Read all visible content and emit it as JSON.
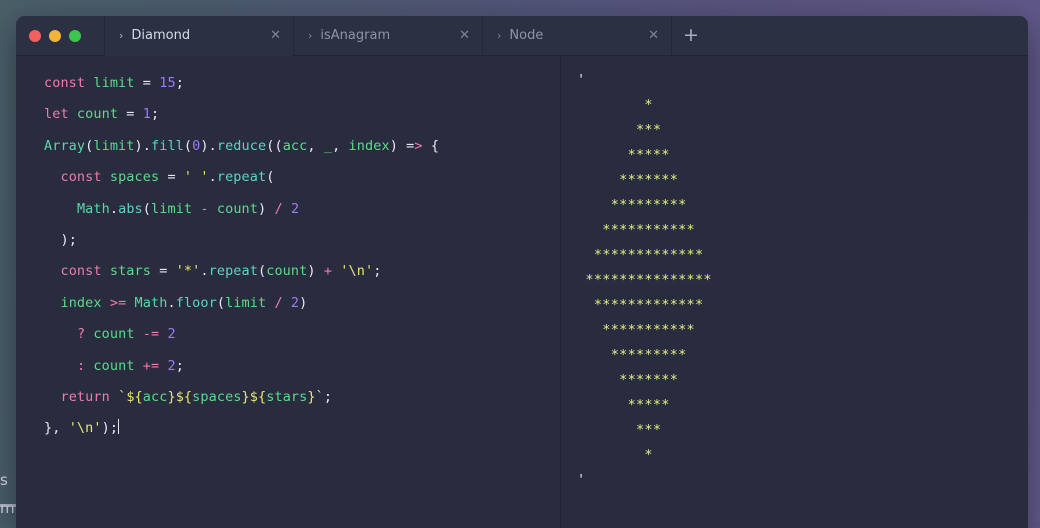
{
  "window": {
    "traffic_lights": [
      {
        "name": "close",
        "color": "#f2615c"
      },
      {
        "name": "minimize",
        "color": "#f2b33d"
      },
      {
        "name": "zoom",
        "color": "#3dc64c"
      }
    ],
    "new_tab_label": "+"
  },
  "tabs": [
    {
      "chevron": "›",
      "label": "Diamond",
      "close": "✕",
      "active": true
    },
    {
      "chevron": "›",
      "label": "isAnagram",
      "close": "✕",
      "active": false
    },
    {
      "chevron": "›",
      "label": "Node",
      "close": "✕",
      "active": false
    }
  ],
  "editor": {
    "language": "javascript",
    "lines": [
      "const limit = 15;",
      "let count = 1;",
      "Array(limit).fill(0).reduce((acc, _, index) => {",
      "  const spaces = ' '.repeat(",
      "    Math.abs(limit - count) / 2",
      "  );",
      "  const stars = '*'.repeat(count) + '\\n';",
      "  index >= Math.floor(limit / 2)",
      "    ? count -= 2",
      "    : count += 2;",
      "  return `${acc}${spaces}${stars}`;",
      "}, '\\n');"
    ]
  },
  "output": {
    "first_quote": "'",
    "last_quote": "'",
    "star_rows": [
      {
        "indent": 7,
        "count": 1
      },
      {
        "indent": 6,
        "count": 3
      },
      {
        "indent": 5,
        "count": 5
      },
      {
        "indent": 4,
        "count": 7
      },
      {
        "indent": 3,
        "count": 9
      },
      {
        "indent": 2,
        "count": 11
      },
      {
        "indent": 1,
        "count": 13
      },
      {
        "indent": 0,
        "count": 15
      },
      {
        "indent": 1,
        "count": 13
      },
      {
        "indent": 2,
        "count": 11
      },
      {
        "indent": 3,
        "count": 9
      },
      {
        "indent": 4,
        "count": 7
      },
      {
        "indent": 5,
        "count": 5
      },
      {
        "indent": 6,
        "count": 3
      },
      {
        "indent": 7,
        "count": 1
      }
    ],
    "star_char": "*"
  },
  "desktop": {
    "background_text_fragments": [
      "s",
      "m"
    ],
    "gradient_from": "#4a5f68",
    "gradient_to": "#635a8c"
  },
  "colors": {
    "window_bg": "#282c3e",
    "titlebar_bg": "#2b3042",
    "keyword": "#f07bab",
    "identifier": "#5ddb8a",
    "method": "#5bd6c4",
    "number": "#9d7cf2",
    "string": "#e8e86a",
    "output_star": "#e4ef83"
  }
}
